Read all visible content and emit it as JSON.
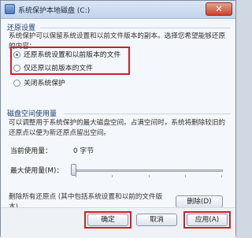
{
  "window": {
    "title": "系统保护本地磁盘 (C:)",
    "close_glyph": "✕"
  },
  "restore": {
    "section_title": "还原设置",
    "description": "系统保护可以保留系统设置和以前文件版本的副本。选择您希望能够还原的内容：",
    "options": [
      {
        "label": "还原系统设置和以前版本的文件",
        "selected": true
      },
      {
        "label": "仅还原以前版本的文件",
        "selected": false
      },
      {
        "label": "关闭系统保护",
        "selected": false
      }
    ]
  },
  "disk": {
    "section_title": "磁盘空间使用量",
    "description": "可以调整用于系统保护的最大磁盘空间。占满空间时，系统将删除较旧的还原点以便为新还原点留出空间。",
    "current_label": "当前使用量：",
    "current_value": "0 字节",
    "max_label": "最大使用量(M)：",
    "max_fraction": 0.0
  },
  "delete": {
    "description": "删除所有还原点 (其中包括系统设置和以前的文件版本)。",
    "button": "删除(D)"
  },
  "footer": {
    "ok": "确定",
    "cancel": "取消",
    "apply": "应用(A)"
  }
}
